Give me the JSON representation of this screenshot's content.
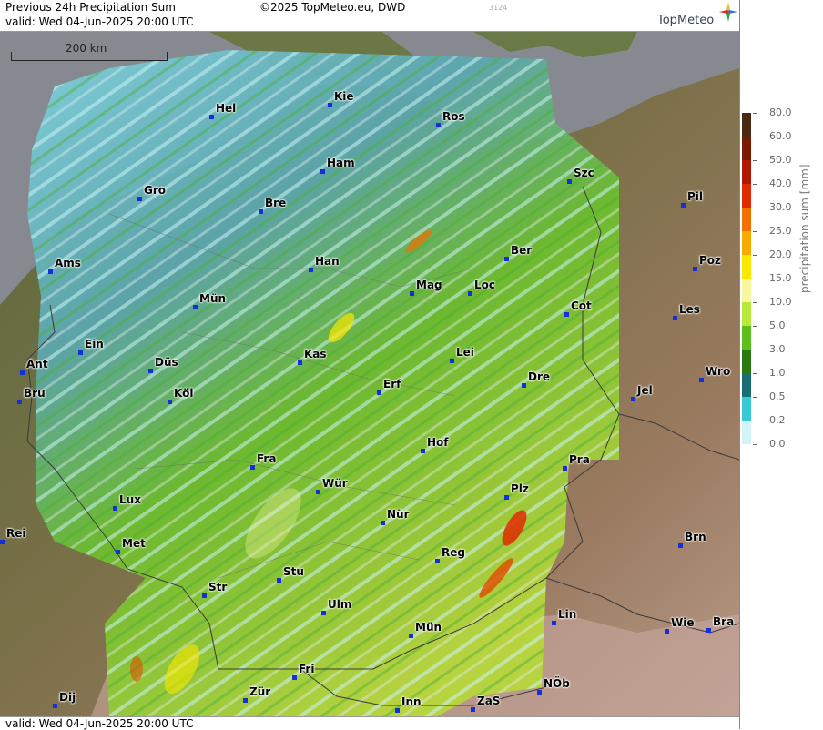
{
  "header": {
    "title": "Previous 24h Precipitation Sum",
    "valid_top": "valid:  Wed  04-Jun-2025 20:00 UTC",
    "copyright": "©2025 TopMeteo.eu, DWD",
    "frame_id": "3124",
    "logo_text": "TopMeteo"
  },
  "footer": {
    "valid_bottom": "valid:  Wed  04-Jun-2025 20:00 UTC"
  },
  "scale": {
    "label": "200 km"
  },
  "legend": {
    "title": "precipitation sum [mm]",
    "entries": [
      {
        "label": "80.0",
        "color": "#4a2a12"
      },
      {
        "label": "60.0",
        "color": "#7a1a00"
      },
      {
        "label": "50.0",
        "color": "#b01800"
      },
      {
        "label": "40.0",
        "color": "#e02a00"
      },
      {
        "label": "30.0",
        "color": "#f07000"
      },
      {
        "label": "25.0",
        "color": "#f6ab00"
      },
      {
        "label": "20.0",
        "color": "#fbe800"
      },
      {
        "label": "15.0",
        "color": "#f6f7a0"
      },
      {
        "label": "10.0",
        "color": "#b8e83a"
      },
      {
        "label": "5.0",
        "color": "#5cbf1e"
      },
      {
        "label": "3.0",
        "color": "#2b7a10"
      },
      {
        "label": "1.0",
        "color": "#1a6d72"
      },
      {
        "label": "0.5",
        "color": "#37c9d4"
      },
      {
        "label": "0.2",
        "color": "#d2f4f7"
      },
      {
        "label": "0.0",
        "color": "#ffffff"
      }
    ]
  },
  "cities": [
    {
      "name": "Hel"
    },
    {
      "name": "Kie"
    },
    {
      "name": "Ros"
    },
    {
      "name": "Ham"
    },
    {
      "name": "Szc"
    },
    {
      "name": "Gro"
    },
    {
      "name": "Bre"
    },
    {
      "name": "Pil"
    },
    {
      "name": "Ber"
    },
    {
      "name": "Ams"
    },
    {
      "name": "Han"
    },
    {
      "name": "Poz"
    },
    {
      "name": "Mag"
    },
    {
      "name": "Loc"
    },
    {
      "name": "Mün"
    },
    {
      "name": "Cot"
    },
    {
      "name": "Les"
    },
    {
      "name": "Ein"
    },
    {
      "name": "Kas"
    },
    {
      "name": "Lei"
    },
    {
      "name": "Ant"
    },
    {
      "name": "Düs"
    },
    {
      "name": "Dre"
    },
    {
      "name": "Wro"
    },
    {
      "name": "Bru"
    },
    {
      "name": "Köl"
    },
    {
      "name": "Erf"
    },
    {
      "name": "Jel"
    },
    {
      "name": "Hof"
    },
    {
      "name": "Fra"
    },
    {
      "name": "Pra"
    },
    {
      "name": "Wür"
    },
    {
      "name": "Plz"
    },
    {
      "name": "Lux"
    },
    {
      "name": "Nür"
    },
    {
      "name": "Rei"
    },
    {
      "name": "Brn"
    },
    {
      "name": "Met"
    },
    {
      "name": "Reg"
    },
    {
      "name": "Stu"
    },
    {
      "name": "Str"
    },
    {
      "name": "Ulm"
    },
    {
      "name": "Lin"
    },
    {
      "name": "Mün"
    },
    {
      "name": "Wie"
    },
    {
      "name": "Bra"
    },
    {
      "name": "Fri"
    },
    {
      "name": "Zür"
    },
    {
      "name": "NÖb"
    },
    {
      "name": "Dij"
    },
    {
      "name": "Inn"
    },
    {
      "name": "ZaS"
    }
  ]
}
